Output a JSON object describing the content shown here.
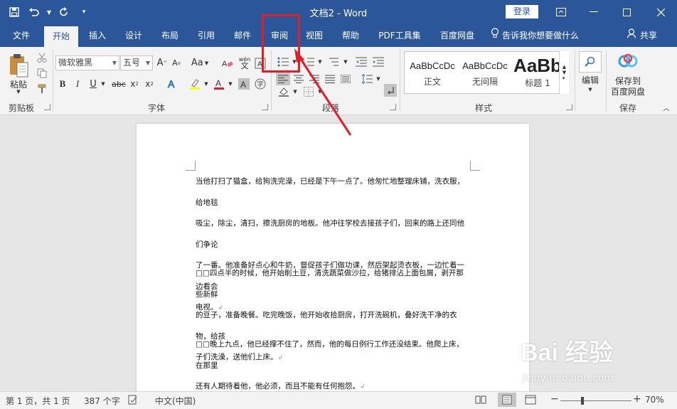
{
  "titlebar": {
    "doc_title": "文档2 - Word",
    "login_label": "登录",
    "colors": {
      "bar": "#2b579a",
      "text": "#ffffff"
    }
  },
  "tabs": [
    {
      "label": "文件",
      "active": false
    },
    {
      "label": "开始",
      "active": true
    },
    {
      "label": "插入",
      "active": false
    },
    {
      "label": "设计",
      "active": false
    },
    {
      "label": "布局",
      "active": false
    },
    {
      "label": "引用",
      "active": false
    },
    {
      "label": "邮件",
      "active": false
    },
    {
      "label": "审阅",
      "active": false
    },
    {
      "label": "视图",
      "active": false
    },
    {
      "label": "帮助",
      "active": false
    },
    {
      "label": "PDF工具集",
      "active": false
    },
    {
      "label": "百度网盘",
      "active": false
    }
  ],
  "tell_me": "告诉我你想要做什么",
  "share_label": "共享",
  "ribbon": {
    "clipboard": {
      "paste_label": "粘贴",
      "group_label": "剪贴板"
    },
    "font": {
      "font_name": "微软雅黑",
      "font_size": "五号",
      "change_case": "Aa",
      "phonetic": "wén",
      "group_label": "字体"
    },
    "paragraph": {
      "group_label": "段落"
    },
    "styles": {
      "items": [
        {
          "sample": "AaBbCcDc",
          "name": "正文"
        },
        {
          "sample": "AaBbCcDc",
          "name": "无间隔"
        },
        {
          "sample": "AaBb",
          "name": "标题 1"
        }
      ],
      "group_label": "样式"
    },
    "editing": {
      "label": "编辑"
    },
    "save": {
      "label_line1": "保存到",
      "label_line2": "百度网盘",
      "group_label": "保存"
    }
  },
  "document": {
    "paragraphs": [
      [
        "当他打扫了猫盒，给狗洗完澡，已经是下午一点了。他匆忙地整理床铺，洗衣服，给地毯",
        "吸尘，除尘，清扫，擦洗厨房的地板。他冲往学校去接孩子们，回来的路上还同他们争论",
        "了一番。他准备好点心和牛奶，督促孩子们做功课，然后架起烫衣板，一边忙着一边看会",
        "电视。"
      ],
      [
        "□□四点半的时候，他开始削土豆，清洗蔬菜做沙拉，给猪排沾上面包屑，剥开那些新鲜",
        "的豆子，准备晚餐。吃完晚饭，他开始收拾厨房，打开洗碗机，叠好洗干净的衣物，给孩",
        "子们洗澡，送他们上床。"
      ],
      [
        "□□晚上九点，他已经撑不住了，然而，他的每日例行工作还没结束。他爬上床，在那里",
        "还有人期待着他，他必须，而且不能有任何抱怨。"
      ]
    ]
  },
  "statusbar": {
    "page_info": "第 1 页，共 1 页",
    "word_count": "387 个字",
    "language": "中文(中国)",
    "zoom": "70%"
  },
  "watermark": {
    "line1": "Bai 经验",
    "line2": "jingyan.baidu.com"
  },
  "annotation": {
    "highlight_color": "#e21f26"
  }
}
